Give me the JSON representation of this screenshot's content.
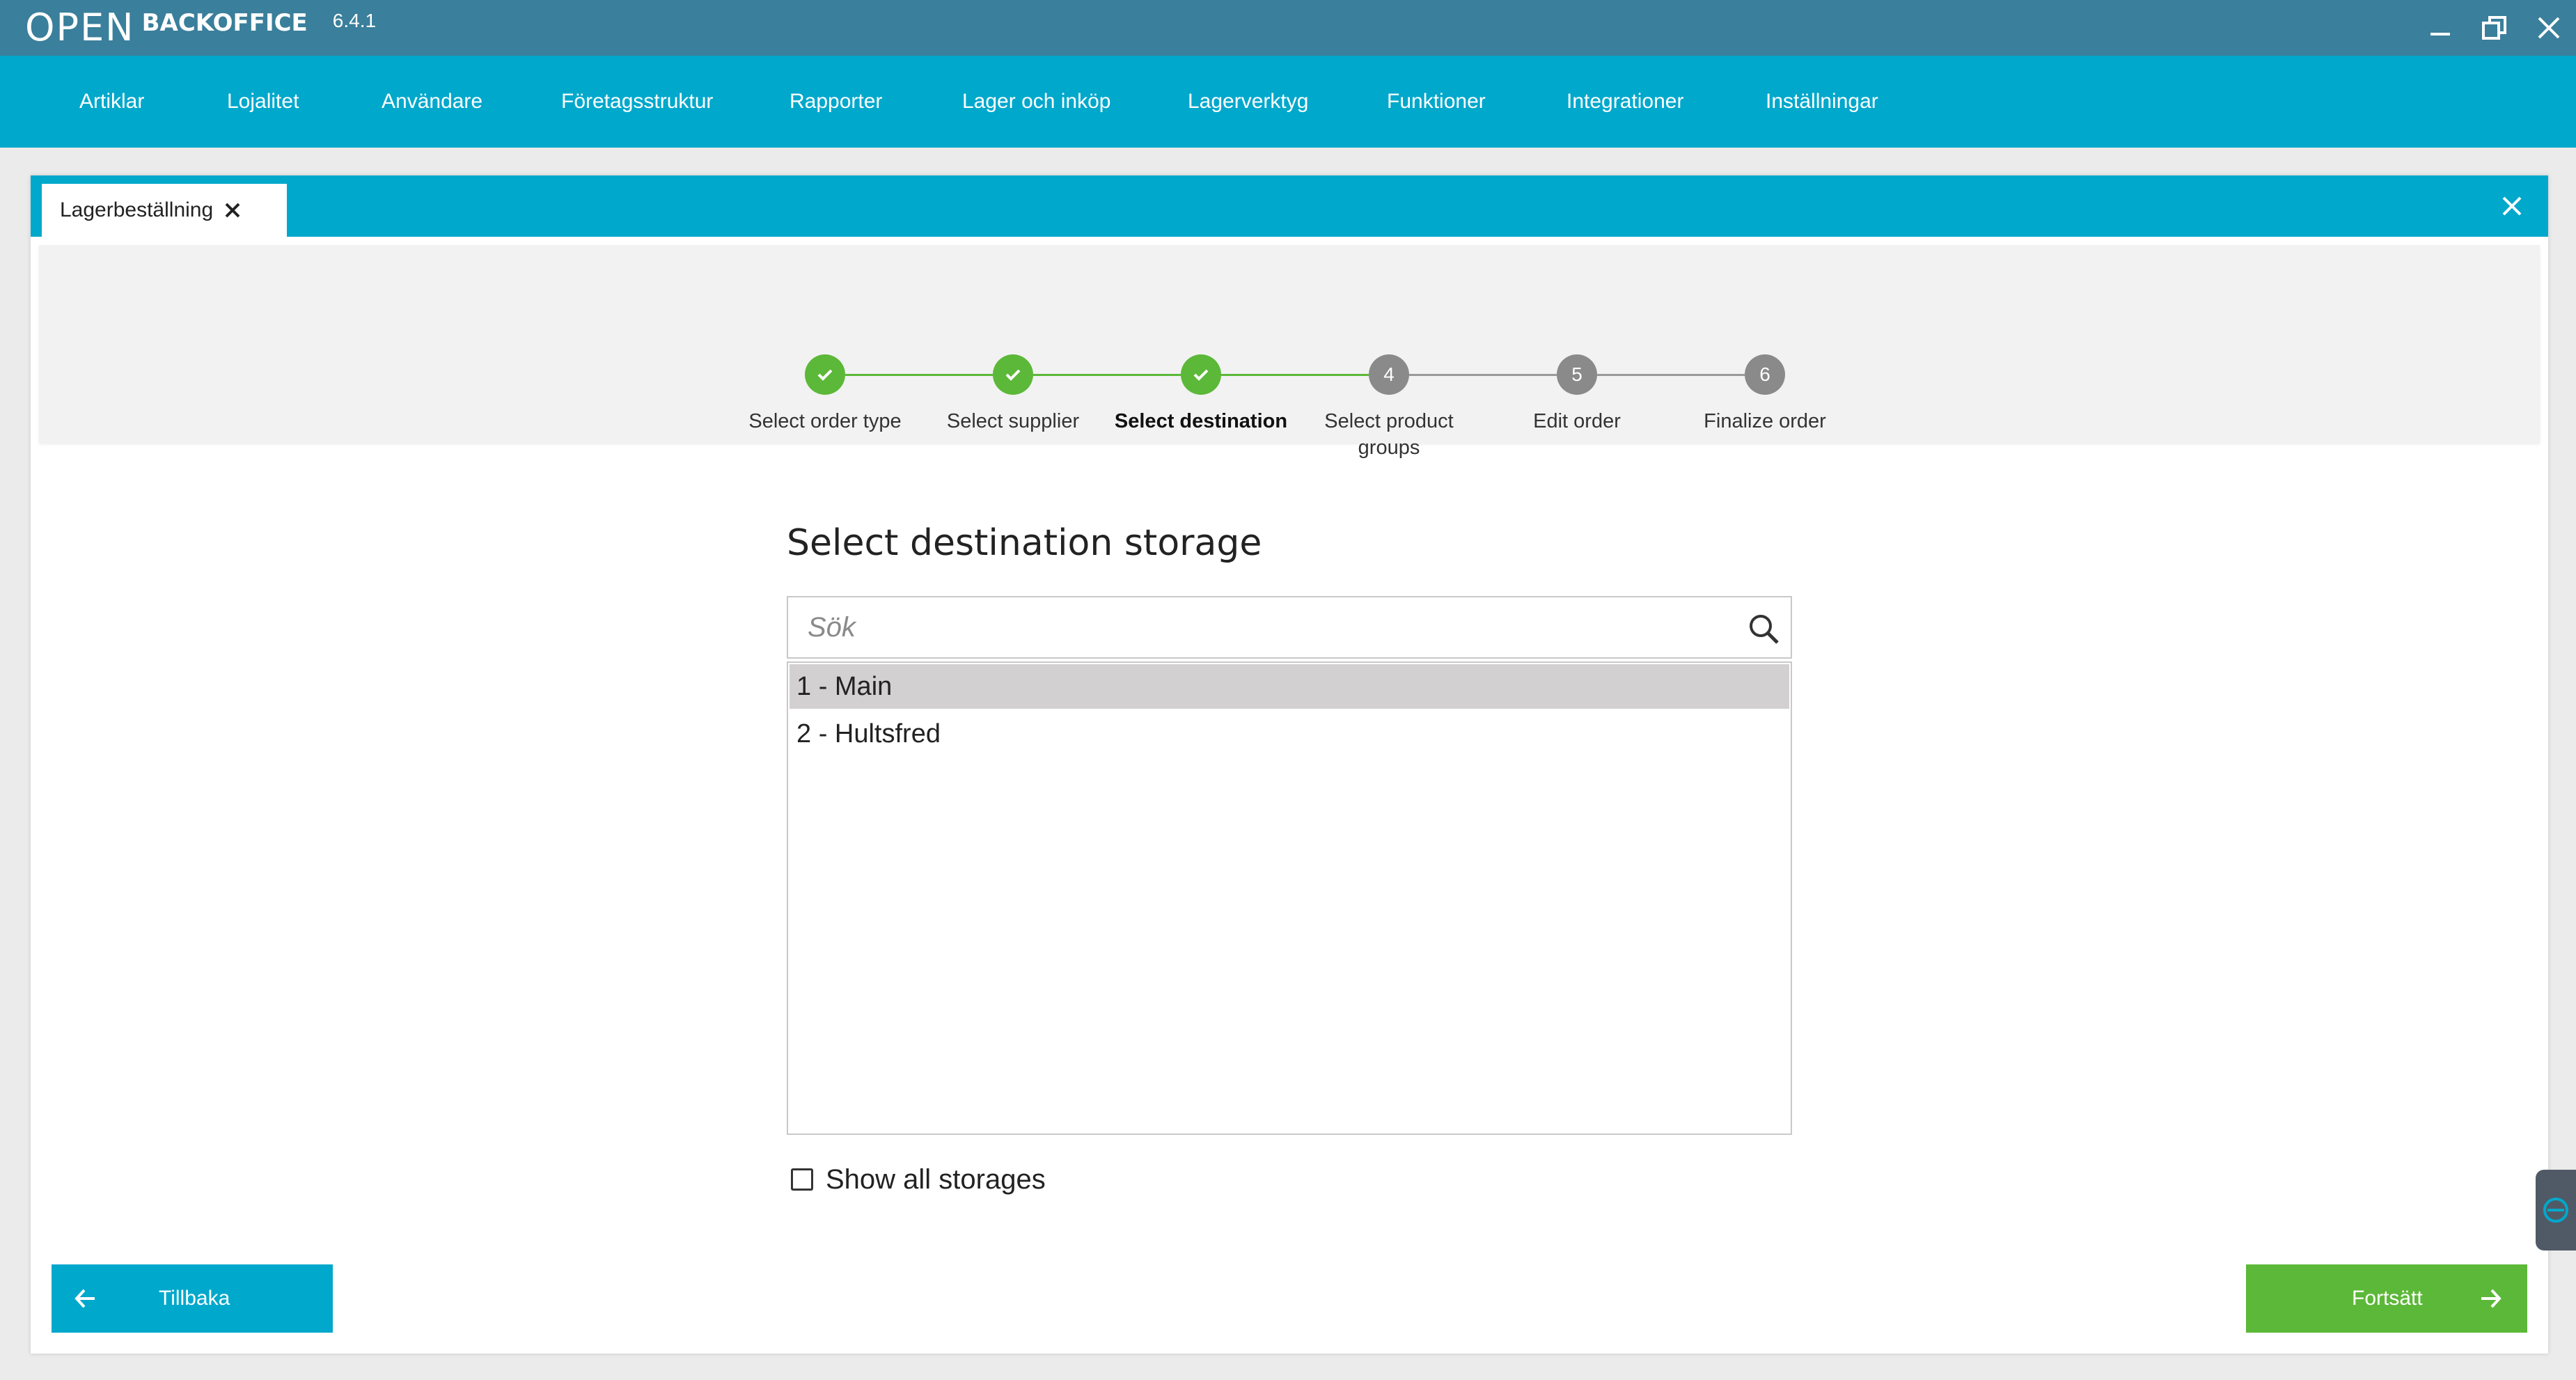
{
  "app": {
    "logo_text": "OPEN",
    "name": "BACKOFFICE",
    "version": "6.4.1"
  },
  "window_controls": [
    "minimize",
    "restore",
    "close"
  ],
  "menu": [
    {
      "label": "Artiklar"
    },
    {
      "label": "Lojalitet"
    },
    {
      "label": "Användare"
    },
    {
      "label": "Företagsstruktur"
    },
    {
      "label": "Rapporter"
    },
    {
      "label": "Lager och inköp"
    },
    {
      "label": "Lagerverktyg"
    },
    {
      "label": "Funktioner"
    },
    {
      "label": "Integrationer"
    },
    {
      "label": "Inställningar"
    }
  ],
  "tab": {
    "label": "Lagerbeställning"
  },
  "steps": [
    {
      "number": "1",
      "label": "Select order type",
      "status": "done"
    },
    {
      "number": "2",
      "label": "Select supplier",
      "status": "done"
    },
    {
      "number": "3",
      "label": "Select destination",
      "status": "active"
    },
    {
      "number": "4",
      "label": "Select product groups",
      "status": "todo"
    },
    {
      "number": "5",
      "label": "Edit order",
      "status": "todo"
    },
    {
      "number": "6",
      "label": "Finalize order",
      "status": "todo"
    }
  ],
  "main": {
    "heading": "Select destination storage",
    "search": {
      "placeholder": "Sök",
      "value": ""
    },
    "storages": [
      {
        "label": "1 - Main",
        "selected": true
      },
      {
        "label": "2 - Hultsfred",
        "selected": false
      }
    ],
    "show_all": {
      "label": "Show all storages",
      "checked": false
    }
  },
  "footer": {
    "back_label": "Tillbaka",
    "next_label": "Fortsätt"
  },
  "colors": {
    "titlebar": "#3a7f9b",
    "accent": "#00a8cc",
    "success": "#5cb838",
    "pending": "#8a8a8a"
  }
}
